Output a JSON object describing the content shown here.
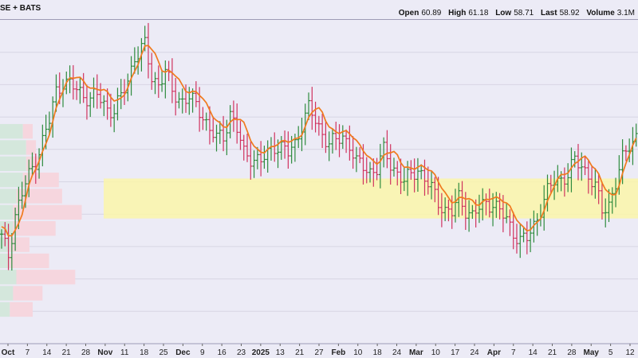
{
  "header": {
    "exchange": "SE + BATS",
    "open_label": "Open",
    "open": "60.89",
    "high_label": "High",
    "high": "61.18",
    "low_label": "Low",
    "low": "58.71",
    "last_label": "Last",
    "last": "58.92",
    "volume_label": "Volume",
    "volume": "3.1M"
  },
  "colors": {
    "background": "#ecebf6",
    "up_bar": "#2e8b3e",
    "down_bar": "#d0335f",
    "moving_average": "#f07a1e",
    "value_area": "#fbf6a9",
    "volume_up": "#d4e7dc",
    "volume_down": "#f6d6de",
    "grid": "#d7d5e4"
  },
  "chart_data": {
    "type": "ohlc",
    "x_tick_labels": [
      {
        "label": "Oct",
        "bold": true
      },
      {
        "label": "7"
      },
      {
        "label": "14"
      },
      {
        "label": "21"
      },
      {
        "label": "28"
      },
      {
        "label": "Nov",
        "bold": true
      },
      {
        "label": "11"
      },
      {
        "label": "18"
      },
      {
        "label": "25"
      },
      {
        "label": "Dec",
        "bold": true
      },
      {
        "label": "9"
      },
      {
        "label": "16"
      },
      {
        "label": "23"
      },
      {
        "label": "2025",
        "bold": true
      },
      {
        "label": "13"
      },
      {
        "label": "21"
      },
      {
        "label": "27"
      },
      {
        "label": "Feb",
        "bold": true
      },
      {
        "label": "10"
      },
      {
        "label": "18"
      },
      {
        "label": "24"
      },
      {
        "label": "Mar",
        "bold": true
      },
      {
        "label": "10"
      },
      {
        "label": "17"
      },
      {
        "label": "24"
      },
      {
        "label": "Apr",
        "bold": true
      },
      {
        "label": "7"
      },
      {
        "label": "14"
      },
      {
        "label": "21"
      },
      {
        "label": "28"
      },
      {
        "label": "May",
        "bold": true
      },
      {
        "label": "5"
      },
      {
        "label": "12"
      }
    ],
    "ylim": [
      40,
      70
    ],
    "close_path": [
      [
        0,
        49.8
      ],
      [
        2,
        48.2
      ],
      [
        4,
        52
      ],
      [
        7,
        54.8
      ],
      [
        10,
        57
      ],
      [
        12,
        58.8
      ],
      [
        14,
        60.6
      ],
      [
        16,
        63.4
      ],
      [
        18,
        64.3
      ],
      [
        20,
        64.0
      ],
      [
        22,
        63.5
      ],
      [
        24,
        63.1
      ],
      [
        26,
        62.7
      ],
      [
        28,
        63.0
      ],
      [
        31,
        61.8
      ],
      [
        33,
        61.6
      ],
      [
        35,
        62.8
      ],
      [
        37,
        64.4
      ],
      [
        39,
        66.6
      ],
      [
        42,
        67.6
      ],
      [
        44,
        64.7
      ],
      [
        46,
        64.1
      ],
      [
        48,
        65.2
      ],
      [
        50,
        63.3
      ],
      [
        53,
        62.5
      ],
      [
        55,
        62.8
      ],
      [
        57,
        62.0
      ],
      [
        59,
        61.2
      ],
      [
        61,
        59.8
      ],
      [
        63,
        59.0
      ],
      [
        65,
        59.2
      ],
      [
        67,
        61.4
      ],
      [
        69,
        59.8
      ],
      [
        71,
        57.6
      ],
      [
        74,
        57.2
      ],
      [
        76,
        56.8
      ],
      [
        78,
        57.6
      ],
      [
        80,
        58.4
      ],
      [
        82,
        58.2
      ],
      [
        84,
        57.6
      ],
      [
        86,
        58.5
      ],
      [
        88,
        60.4
      ],
      [
        90,
        61.8
      ],
      [
        92,
        60.6
      ],
      [
        94,
        59.5
      ],
      [
        96,
        58.6
      ],
      [
        98,
        58.7
      ],
      [
        100,
        59.2
      ],
      [
        102,
        58.5
      ],
      [
        104,
        56.7
      ],
      [
        106,
        56.4
      ],
      [
        108,
        56.0
      ],
      [
        110,
        56.2
      ],
      [
        112,
        57.8
      ],
      [
        114,
        56.7
      ],
      [
        116,
        55.8
      ],
      [
        118,
        55.0
      ],
      [
        120,
        55.6
      ],
      [
        122,
        56.3
      ],
      [
        124,
        55.2
      ],
      [
        126,
        54.3
      ],
      [
        128,
        53.2
      ],
      [
        130,
        52.4
      ],
      [
        132,
        52.1
      ],
      [
        134,
        53.5
      ],
      [
        136,
        52.5
      ],
      [
        138,
        51.8
      ],
      [
        140,
        52.5
      ],
      [
        142,
        53.1
      ],
      [
        144,
        53.0
      ],
      [
        146,
        52.2
      ],
      [
        148,
        51.5
      ],
      [
        150,
        50.4
      ],
      [
        152,
        49.5
      ],
      [
        154,
        49.7
      ],
      [
        156,
        51.0
      ],
      [
        158,
        52.5
      ],
      [
        160,
        54.0
      ],
      [
        162,
        55.1
      ],
      [
        164,
        55.3
      ],
      [
        166,
        55.6
      ],
      [
        168,
        56.9
      ],
      [
        170,
        56.6
      ],
      [
        172,
        55.6
      ],
      [
        174,
        54.4
      ],
      [
        176,
        52.4
      ],
      [
        178,
        53.0
      ],
      [
        180,
        54.8
      ],
      [
        182,
        57.0
      ],
      [
        184,
        58.6
      ],
      [
        186,
        59.2
      ]
    ],
    "value_area": [
      51.6,
      55.3
    ],
    "volume_profile": [
      {
        "price": 59.6,
        "up": 7,
        "down": 3
      },
      {
        "price": 58.1,
        "up": 8,
        "down": 3
      },
      {
        "price": 56.6,
        "up": 8,
        "down": 4
      },
      {
        "price": 55.1,
        "up": 7,
        "down": 11
      },
      {
        "price": 53.6,
        "up": 5,
        "down": 14
      },
      {
        "price": 52.1,
        "up": 4,
        "down": 21
      },
      {
        "price": 50.6,
        "up": 4,
        "down": 13
      },
      {
        "price": 49.1,
        "up": 3,
        "down": 6
      },
      {
        "price": 47.6,
        "up": 3,
        "down": 12
      },
      {
        "price": 46.1,
        "up": 5,
        "down": 18
      },
      {
        "price": 44.6,
        "up": 4,
        "down": 9
      },
      {
        "price": 43.1,
        "up": 3,
        "down": 7
      }
    ]
  }
}
